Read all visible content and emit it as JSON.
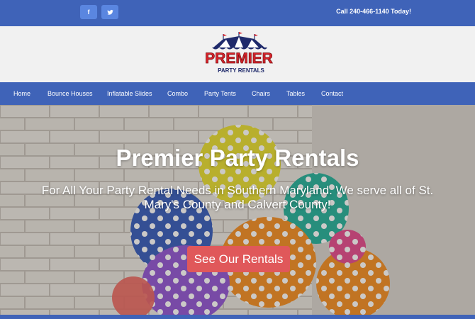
{
  "colors": {
    "brand_blue": "#3f63b8",
    "social_blue": "#5a86e0",
    "cta_red": "#e0585a",
    "logo_red": "#d8232a",
    "logo_navy": "#1f2a6b"
  },
  "topbar": {
    "social": [
      {
        "label": "f",
        "icon": "facebook-icon"
      },
      {
        "label": "",
        "icon": "twitter-icon"
      }
    ],
    "call_text": "Call 240-466-1140 Today!"
  },
  "logo": {
    "main": "PREMIER",
    "sub": "PARTY RENTALS"
  },
  "nav": {
    "items": [
      {
        "label": "Home"
      },
      {
        "label": "Bounce Houses"
      },
      {
        "label": "Inflatable Slides"
      },
      {
        "label": "Combo"
      },
      {
        "label": "Party Tents"
      },
      {
        "label": "Chairs"
      },
      {
        "label": "Tables"
      },
      {
        "label": "Contact"
      }
    ]
  },
  "hero": {
    "title": "Premier Party Rentals",
    "subtitle": "For All Your Party Rental Needs in Southern Maryland. We serve all of St. Mary's County and Calvert County!",
    "cta_label": "See Our Rentals"
  }
}
